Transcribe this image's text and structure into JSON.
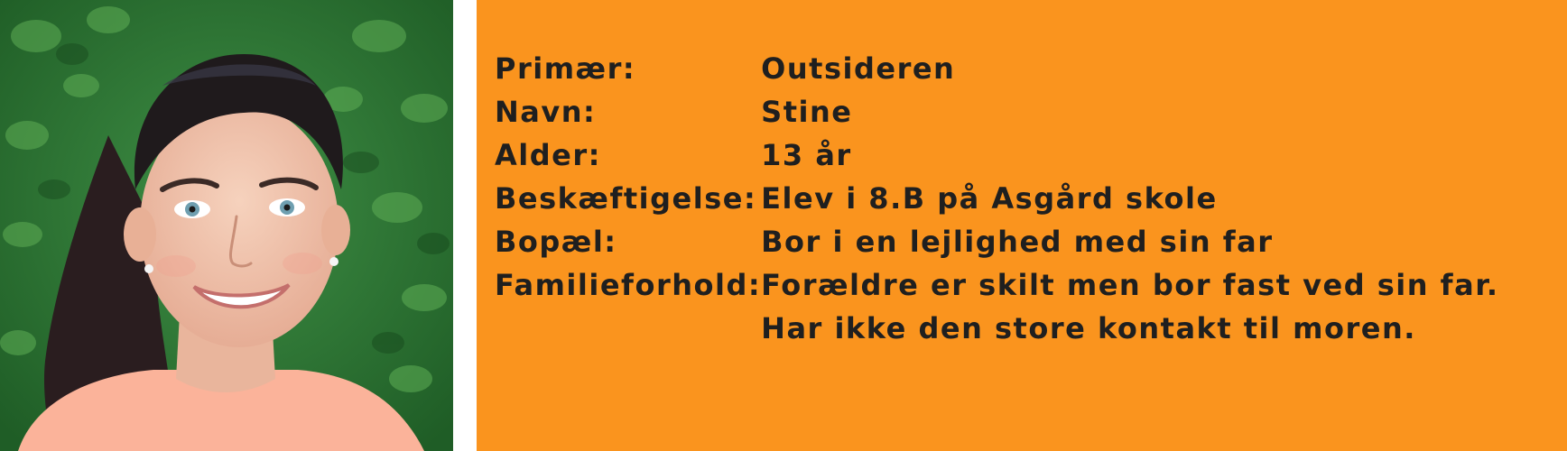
{
  "persona": {
    "photo_alt": "",
    "rows": [
      {
        "label": "Primær:",
        "value": "Outsideren"
      },
      {
        "label": "Navn:",
        "value": "Stine"
      },
      {
        "label": "Alder:",
        "value": "13 år"
      },
      {
        "label": "Beskæftigelse:",
        "value": "Elev i 8.B på Asgård skole"
      },
      {
        "label": "Bopæl:",
        "value": "Bor i en lejlighed med sin far"
      },
      {
        "label": "Familieforhold:",
        "value": "Forældre er skilt men bor fast ved sin far. Har ikke den store kontakt til moren."
      }
    ]
  },
  "colors": {
    "panel_background": "#fa941e",
    "text": "#1f1f1f",
    "foliage": "#2f7d34",
    "hair": "#1f1a1c",
    "skin": "#f0c3ac",
    "shirt": "#fbb39a"
  }
}
